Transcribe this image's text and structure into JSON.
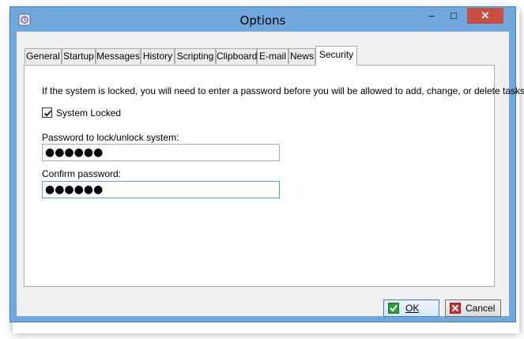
{
  "window": {
    "title": "Options",
    "controls": {
      "minimize": "–",
      "maximize": "□",
      "close": "✕"
    }
  },
  "tabs": [
    {
      "label": "General"
    },
    {
      "label": "Startup"
    },
    {
      "label": "Messages"
    },
    {
      "label": "History"
    },
    {
      "label": "Scripting"
    },
    {
      "label": "Clipboard"
    },
    {
      "label": "E-mail"
    },
    {
      "label": "News"
    },
    {
      "label": "Security",
      "active": true
    }
  ],
  "security": {
    "description": "If the system is locked, you will need to enter a password before you will be allowed to add, change, or delete tasks.",
    "system_locked_label": "System Locked",
    "system_locked_checked": true,
    "password_label": "Password to lock/unlock system:",
    "password_value": "●●●●●●",
    "confirm_label": "Confirm password:",
    "confirm_value": "●●●●●●"
  },
  "buttons": {
    "ok_label": "OK",
    "cancel_label": "Cancel"
  },
  "icons": {
    "app": "app-icon",
    "ok": "checkmark-icon",
    "cancel": "cross-icon"
  },
  "colors": {
    "title_bar": "#6fa8dc",
    "close_button": "#c74f41",
    "focus_border": "#569de5"
  }
}
